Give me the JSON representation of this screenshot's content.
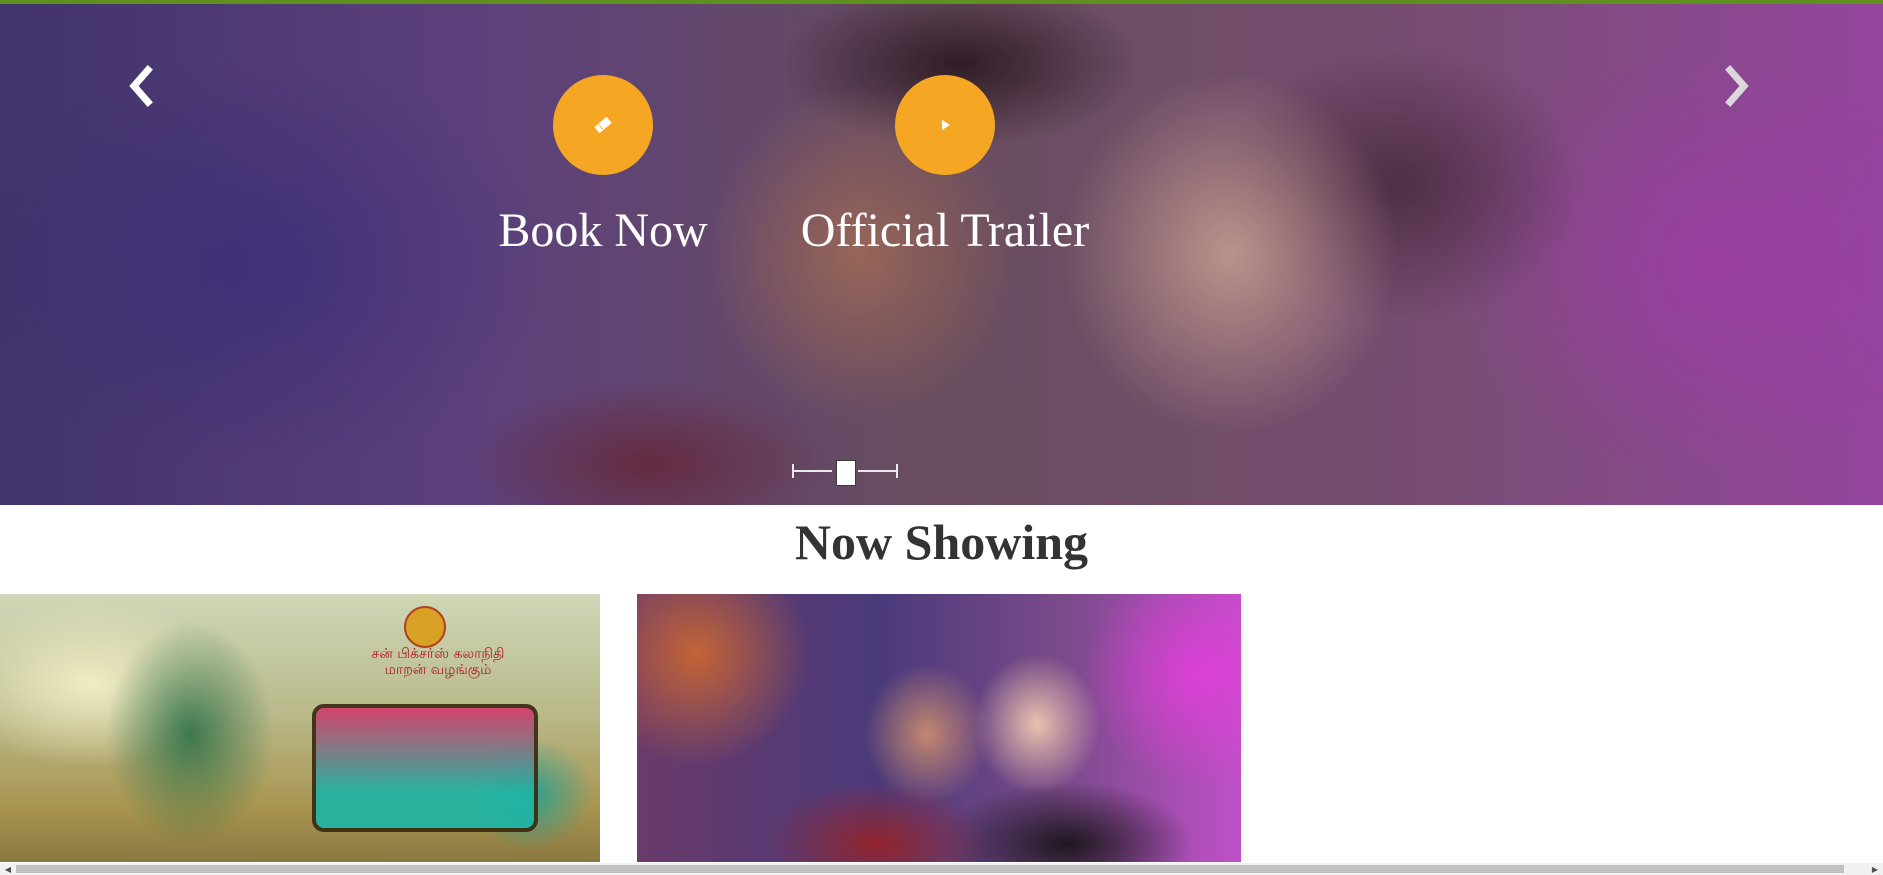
{
  "hero": {
    "prev_icon": "chevron-left-icon",
    "next_icon": "chevron-right-icon",
    "book": {
      "label": "Book Now",
      "icon": "ticket-icon"
    },
    "trailer": {
      "label": "Official Trailer",
      "icon": "play-icon"
    },
    "slide_count": 3,
    "active_slide": 2
  },
  "section": {
    "title": "Now Showing"
  },
  "posters": [
    {
      "credit": "சன் பிக்சர்ஸ் கலாநிதி மாறன் வழங்கும்"
    },
    {
      "credit": ""
    }
  ],
  "colors": {
    "accent": "#f5a623",
    "top_bar": "#5f8f1f",
    "title_text": "#333333"
  }
}
